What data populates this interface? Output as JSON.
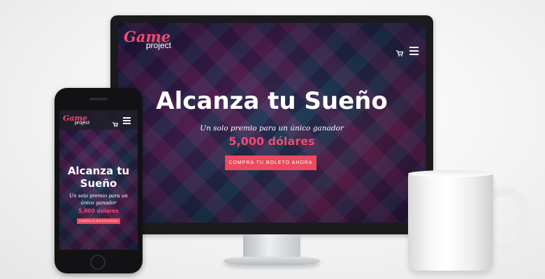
{
  "desktop": {
    "logo": {
      "game": "Game",
      "project": "project"
    },
    "hero": {
      "title": "Alcanza tu Sueño",
      "subtitle": "Un solo premio para un único ganador",
      "prize": "5,000 dólares",
      "cta": "COMPRA TU BOLETO AHORA"
    },
    "icons": [
      "cart-icon",
      "hamburger-menu-icon"
    ]
  },
  "mobile": {
    "logo": {
      "game": "Game",
      "project": "project"
    },
    "hero": {
      "title_line1": "Alcanza tu",
      "title_line2": "Sueño",
      "subtitle_line1": "Un solo premio para un",
      "subtitle_line2": "único ganador",
      "prize": "5,000 dólares",
      "cta": "COMPRA TU BOLETO AHORA"
    },
    "icons": [
      "cart-icon",
      "hamburger-menu-icon"
    ]
  },
  "colors": {
    "accent": "#ef4a73",
    "cta": "#ea4b5e",
    "text": "#ffffff"
  }
}
